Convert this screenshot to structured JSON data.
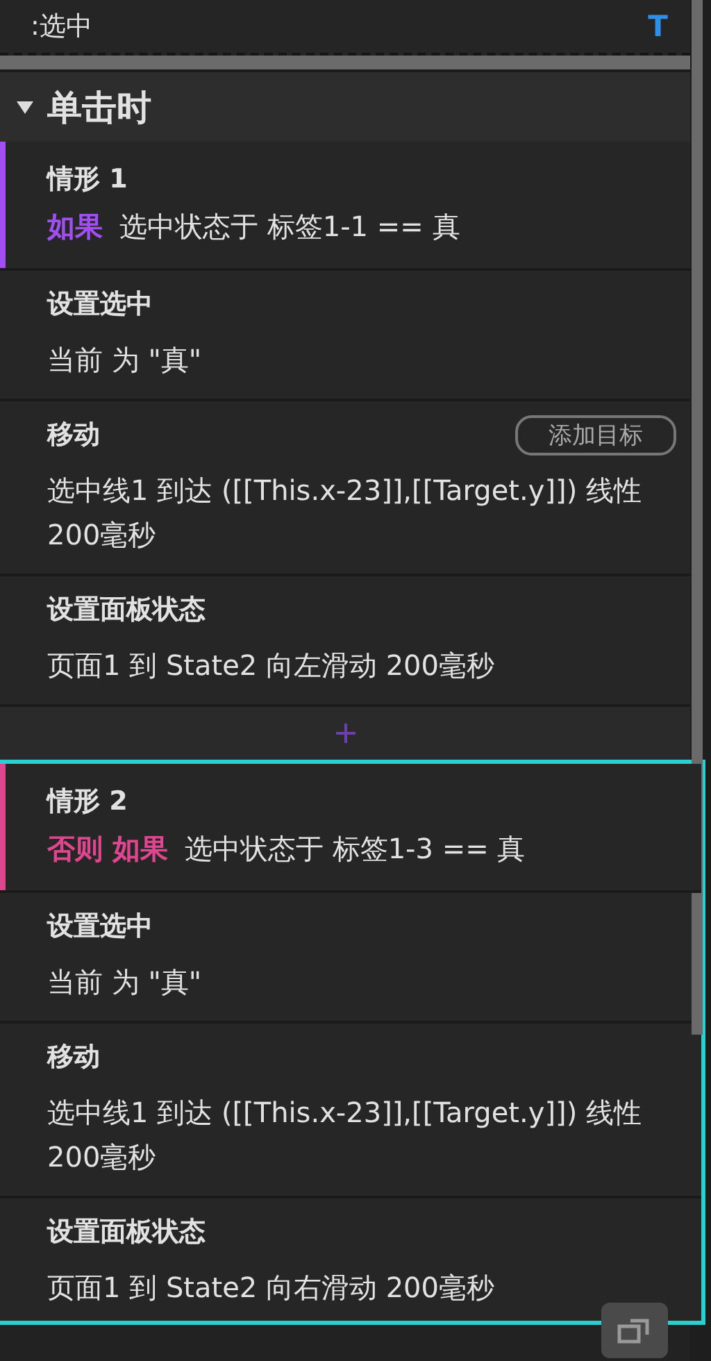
{
  "top_row": {
    "label": ":选中",
    "type_marker": "T"
  },
  "event": {
    "title": "单击时",
    "expanded": true
  },
  "cases": [
    {
      "title": "情形 1",
      "keyword": "如果",
      "color": "#a24ef5",
      "condition": "选中状态于 标签1-1 == 真",
      "selected": false,
      "actions": [
        {
          "name": "设置选中",
          "description": "当前 为 \"真\""
        },
        {
          "name": "移动",
          "description": "选中线1 到达 ([[This.x-23]],[[Target.y]]) 线性 200毫秒",
          "button": "添加目标"
        },
        {
          "name": "设置面板状态",
          "description": "页面1 到 State2 向左滑动 200毫秒"
        }
      ]
    },
    {
      "title": "情形 2",
      "keyword": "否则 如果",
      "color": "#e0468f",
      "condition": "选中状态于 标签1-3 == 真",
      "selected": true,
      "actions": [
        {
          "name": "设置选中",
          "description": "当前 为 \"真\""
        },
        {
          "name": "移动",
          "description": "选中线1 到达 ([[This.x-23]],[[Target.y]]) 线性 200毫秒"
        },
        {
          "name": "设置面板状态",
          "description": "页面1 到 State2 向右滑动 200毫秒"
        }
      ]
    }
  ]
}
